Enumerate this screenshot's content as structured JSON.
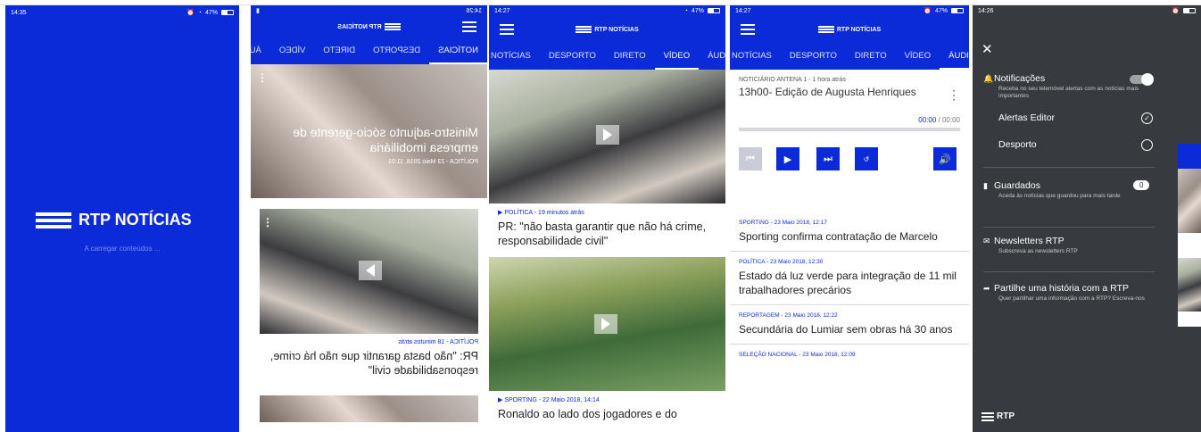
{
  "colors": {
    "brand": "#0b2bd9",
    "drawer": "#373b3f"
  },
  "brand": "RTP",
  "brand_name": "RTP NOTÍCIAS",
  "splash": {
    "time": "14:35",
    "battery": "47%",
    "loading": "A carregar conteúdos ..."
  },
  "mirrored": {
    "time": "14:26",
    "tabs": [
      "NOTÍCIAS",
      "DESPORTO",
      "DIRETO",
      "VÍDEO",
      "ÁUDIO"
    ],
    "headline1": "Ministro-adjunto sócio-gerente de empresa imobiliária",
    "meta1": "POLÍTICA - 23 Maio 2018, 11:01",
    "cat2": "POLÍTICA - 18 minutos atrás",
    "headline2": "PR: \"não basta garantir que não há crime, responsabilidade civil\""
  },
  "video": {
    "time": "14:27",
    "battery": "47%",
    "tabs": [
      "NOTÍCIAS",
      "DESPORTO",
      "DIRETO",
      "VÍDEO",
      "ÁUDIO"
    ],
    "cat1": "POLÍTICA - 19 minutos atrás",
    "headline1": "PR: \"não basta garantir que não há crime, responsabilidade civil\"",
    "cat2": "SPORTING - 22 Maio 2018, 14:14",
    "headline2": "Ronaldo ao lado dos jogadores e do"
  },
  "audio": {
    "time": "14:27",
    "battery": "47%",
    "tabs": [
      "NOTÍCIAS",
      "DESPORTO",
      "DIRETO",
      "VÍDEO",
      "ÁUDIO"
    ],
    "program": "NOTICIÁRIO ANTENA 1 - 1 hora atrás",
    "title": "13h00- Edição de Augusta Henriques",
    "time_current": "00:00",
    "time_total": "/ 00:00",
    "articles": [
      {
        "cat": "SPORTING - 23 Maio 2018, 12:17",
        "headline": "Sporting confirma contratação de Marcelo"
      },
      {
        "cat": "POLÍTICA - 23 Maio 2018, 12:30",
        "headline": "Estado dá luz verde para integração de 11 mil trabalhadores precários"
      },
      {
        "cat": "REPORTAGEM - 23 Maio 2018, 12:22",
        "headline": "Secundária do Lumiar sem obras há 30 anos"
      },
      {
        "cat": "SELEÇÃO NACIONAL - 23 Maio 2018, 12:09",
        "headline": ""
      }
    ]
  },
  "drawer": {
    "time": "14:26",
    "notif_title": "Notificações",
    "notif_sub": "Receba no seu telemóvel alertas com as notícias mais importantes",
    "alertas": "Alertas Editor",
    "desporto": "Desporto",
    "guardados": "Guardados",
    "guardados_count": "0",
    "guardados_sub": "Aceda às notícias que guardou para mais tarde",
    "newsletters": "Newsletters RTP",
    "newsletters_sub": "Subscreva as newsletters RTP",
    "partilhe": "Partilhe uma história com a RTP",
    "partilhe_sub": "Quer partilhar uma informação com a RTP? Escreva-nos"
  }
}
